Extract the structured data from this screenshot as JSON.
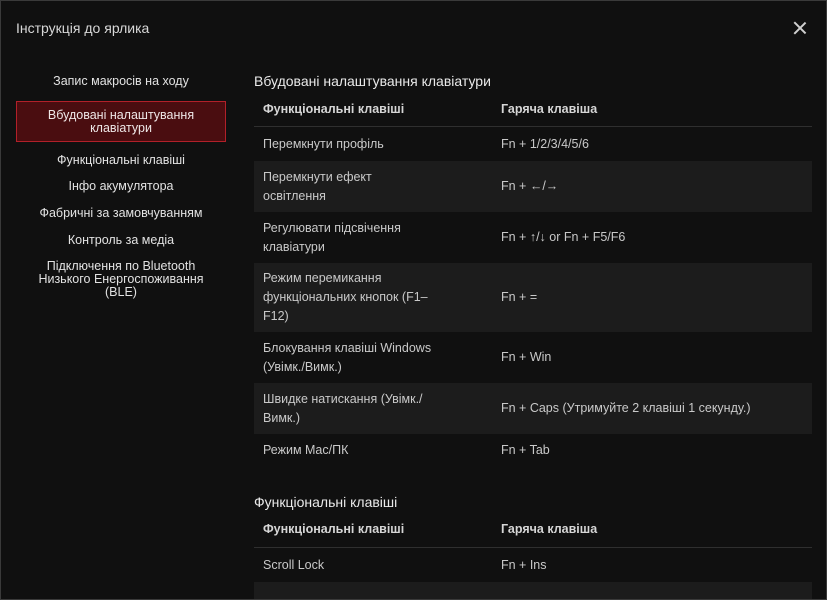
{
  "window": {
    "title": "Інструкція до ярлика"
  },
  "sidebar": {
    "items": [
      {
        "label": "Запис макросів на ходу"
      },
      {
        "label": "Вбудовані налаштування клавіатури"
      },
      {
        "label": "Функціональні клавіші"
      },
      {
        "label": "Інфо акумулятора"
      },
      {
        "label": "Фабричні за замовчуванням"
      },
      {
        "label": "Контроль за медіа"
      },
      {
        "label": "Підключення по Bluetooth Низького Енергоспоживання (BLE)"
      }
    ],
    "active_index": 1
  },
  "sections": [
    {
      "title": "Вбудовані налаштування клавіатури",
      "headers": {
        "col1": "Функціональні клавіші",
        "col2": "Гаряча клавіша"
      },
      "rows": [
        {
          "action": "Перемкнути профіль",
          "hotkey": "Fn + 1/2/3/4/5/6"
        },
        {
          "action": "Перемкнути ефект освітлення",
          "hotkey": "Fn + ←/→"
        },
        {
          "action": "Регулювати підсвічення клавіатури",
          "hotkey": "Fn + ↑/↓ or Fn + F5/F6"
        },
        {
          "action": "Режим перемикання функціональних кнопок (F1–F12)",
          "hotkey": "Fn + ="
        },
        {
          "action": "Блокування клавіші Windows (Увімк./Вимк.)",
          "hotkey": "Fn + Win"
        },
        {
          "action": "Швидке натискання (Увімк./Вимк.)",
          "hotkey": "Fn + Caps (Утримуйте 2 клавіші 1 секунду.)"
        },
        {
          "action": "Режим Mac/ПК",
          "hotkey": "Fn + Tab"
        }
      ]
    },
    {
      "title": "Функціональні клавіші",
      "headers": {
        "col1": "Функціональні клавіші",
        "col2": "Гаряча клавіша"
      },
      "rows": [
        {
          "action": "Scroll Lock",
          "hotkey": "Fn + Ins"
        }
      ]
    }
  ],
  "colors": {
    "accent": "#b22029",
    "active_bg": "#4a0d10",
    "background": "#101010",
    "row_alt": "#1c1c1c"
  }
}
